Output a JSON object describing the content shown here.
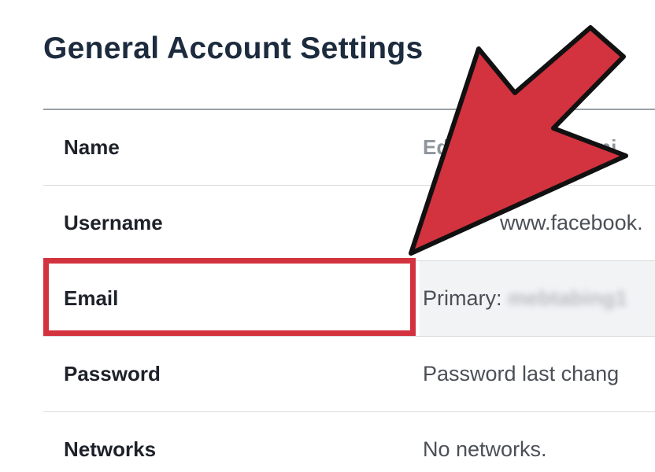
{
  "page": {
    "title": "General Account Settings"
  },
  "settings": {
    "rows": [
      {
        "label": "Name",
        "value": "Ed",
        "value_tail": "ni"
      },
      {
        "label": "Username",
        "value": "www.facebook."
      },
      {
        "label": "Email",
        "value_prefix": "Primary:",
        "value_blurred": "mebtabing1"
      },
      {
        "label": "Password",
        "value": "Password last chang"
      },
      {
        "label": "Networks",
        "value": "No networks."
      }
    ]
  },
  "annotation": {
    "highlight_color": "#d3323f",
    "arrow_fill": "#d3323f",
    "arrow_stroke": "#111111"
  }
}
